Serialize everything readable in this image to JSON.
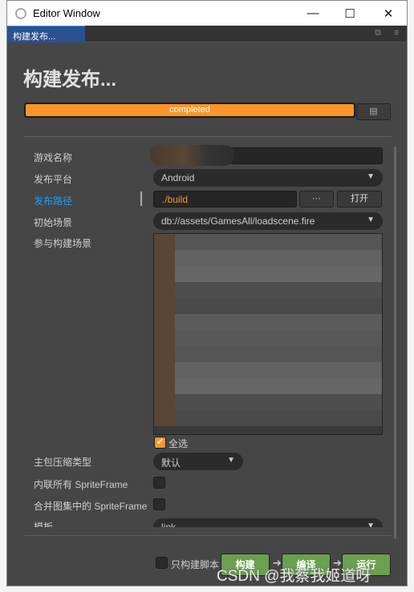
{
  "window": {
    "title": "Editor Window",
    "minimize": "—",
    "maximize": "☐",
    "close": "✕"
  },
  "tab": {
    "label": "构建发布...",
    "popout_icon": "⧉",
    "menu_icon": "≡"
  },
  "page_title": "构建发布...",
  "progress": {
    "label": "completed",
    "percent": 100,
    "color": "#fa962a"
  },
  "form": {
    "game_name_label": "游戏名称",
    "game_name_value": "",
    "platform_label": "发布平台",
    "platform_value": "Android",
    "path_label": "发布路径",
    "path_value": "./build",
    "browse_label": "···",
    "open_label": "打开",
    "start_scene_label": "初始场景",
    "start_scene_value": "db://assets/GamesAll/loadscene.fire",
    "scenes_label": "参与构建场景",
    "select_all_label": "全选",
    "select_all_checked": true,
    "compression_label": "主包压缩类型",
    "compression_value": "默认",
    "inline_label": "内联所有 SpriteFrame",
    "inline_checked": false,
    "merge_label": "合并图集中的 SpriteFrame",
    "merge_checked": false,
    "template_label": "模板",
    "template_value": "link"
  },
  "footer": {
    "script_only_label": "只构建脚本",
    "build": "构建",
    "compile": "编译",
    "run": "运行"
  },
  "watermark": "CSDN @我蔡我姬道呀"
}
